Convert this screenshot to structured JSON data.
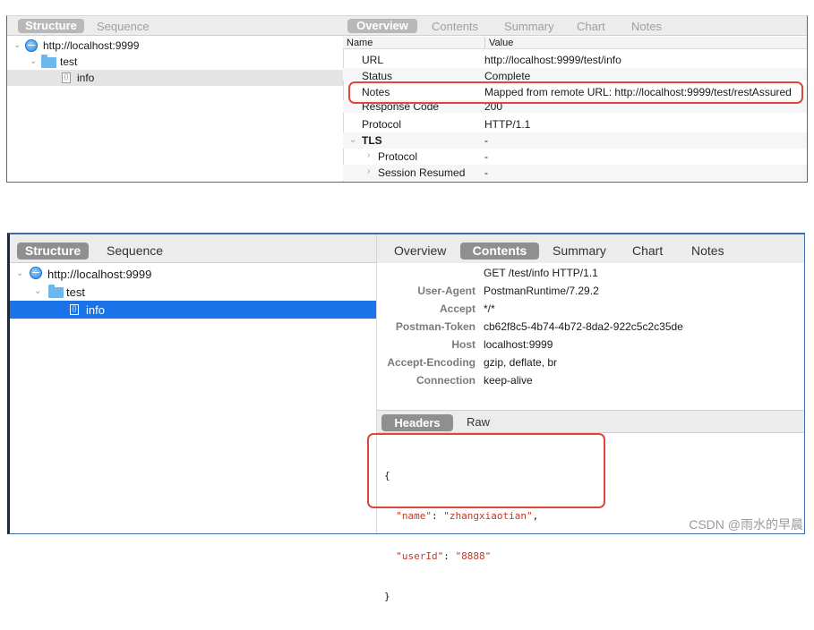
{
  "top": {
    "left_tabs": [
      "Structure",
      "Sequence"
    ],
    "right_tabs": [
      "Overview",
      "Contents",
      "Summary",
      "Chart",
      "Notes"
    ],
    "tree": {
      "host": "http://localhost:9999",
      "folder": "test",
      "file": "info"
    },
    "columns": {
      "name": "Name",
      "value": "Value"
    },
    "rows": [
      {
        "name": "URL",
        "value": "http://localhost:9999/test/info"
      },
      {
        "name": "Status",
        "value": "Complete"
      },
      {
        "name": "Notes",
        "value": "Mapped from remote URL: http://localhost:9999/test/restAssured"
      },
      {
        "name": "Response Code",
        "value": "200"
      },
      {
        "name": "Protocol",
        "value": "HTTP/1.1"
      },
      {
        "name": "TLS",
        "value": "-"
      },
      {
        "name": "Protocol",
        "value": "-"
      },
      {
        "name": "Session Resumed",
        "value": "-"
      }
    ]
  },
  "bottom": {
    "left_tabs": [
      "Structure",
      "Sequence"
    ],
    "right_tabs": [
      "Overview",
      "Contents",
      "Summary",
      "Chart",
      "Notes"
    ],
    "tree": {
      "host": "http://localhost:9999",
      "folder": "test",
      "file": "info"
    },
    "request_line": "GET /test/info HTTP/1.1",
    "headers": [
      {
        "key": "User-Agent",
        "value": "PostmanRuntime/7.29.2"
      },
      {
        "key": "Accept",
        "value": "*/*"
      },
      {
        "key": "Postman-Token",
        "value": "cb62f8c5-4b74-4b72-8da2-922c5c2c35de"
      },
      {
        "key": "Host",
        "value": "localhost:9999"
      },
      {
        "key": "Accept-Encoding",
        "value": "gzip, deflate, br"
      },
      {
        "key": "Connection",
        "value": "keep-alive"
      }
    ],
    "body_tabs": [
      "Headers",
      "Raw"
    ],
    "json": {
      "open": "{",
      "k1": "\"name\"",
      "v1": "\"zhangxiaotian\"",
      "k2": "\"userId\"",
      "v2": "\"8888\"",
      "close": "}"
    }
  },
  "watermark": "CSDN @雨水的早晨",
  "colors": {
    "accent_blue": "#1a73e8",
    "highlight_red": "#e0463a"
  }
}
